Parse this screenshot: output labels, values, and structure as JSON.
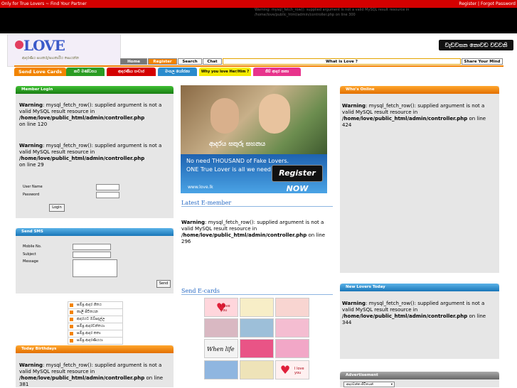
{
  "topbar": {
    "left_text": "Only for True Lovers ~ Find Your Partner",
    "right_text": "Register | Forgot Password"
  },
  "header_warning": {
    "line1": "Warning: mysql_fetch_row(): supplied argument is not a valid MySQL result resource in",
    "line2": "/home/love/public_html/admin/controller.php on line 300"
  },
  "logo": {
    "text": "LOVE",
    "tagline": "ආදරණීය සහකරු/සහකාරිය සොයන්න"
  },
  "site_title": "වැඩවසන නොවඩ වඩවනි",
  "nav": {
    "home": "Home",
    "register": "Register",
    "search": "Search",
    "chat": "Chat",
    "what_is_love": "What is Love ?",
    "share": "Share Your Mind"
  },
  "tabs": {
    "send_love_cards": "Send Love Cards",
    "tab2": "කවි මණ්ඩපය",
    "tab3": "ආදරණීය සංචාර",
    "tab4": "මංගල යෝජනා",
    "tab5": "Why you love Her/Him ?",
    "tab6": "ශිම් ආදර කතා"
  },
  "login": {
    "title": "Member Login",
    "w1_label": "Warning",
    "w1_text": ": mysql_fetch_row(): supplied argument is not a valid MySQL result resource in",
    "w1_path": "/home/love/public_html/admin/controller.php",
    "w1_line": "on line 120",
    "w2_label": "Warning",
    "w2_text": ": mysql_fetch_row(): supplied argument is not a valid MySQL result resource in",
    "w2_path": "/home/love/public_html/admin/controller.php",
    "w2_line": "on line 29",
    "username_label": "User Name",
    "password_label": "Password",
    "button": "Login"
  },
  "sms": {
    "title": "Send SMS",
    "mobile_label": "Mobile No.",
    "subject_label": "Subject",
    "message_label": "Message",
    "button": "Send"
  },
  "menu_list": [
    "සම්ප්‍ර ආදර ගීතය",
    "කාලී ජීවිතයන",
    "ආදරයට ඔබ්සදැල්ල",
    "සම්ප්‍ර ආදරවන්තයා",
    "සම්ප්‍ර ආදර කතා",
    "සම්ප්‍ර ආදරණීයයා"
  ],
  "birthdays": {
    "title": "Today Birthdays",
    "label": "Warning",
    "text": ": mysql_fetch_row(): supplied argument is not a valid MySQL result resource in",
    "path": "/home/love/public_html/admin/controller.php",
    "line": "on line 381"
  },
  "banner": {
    "caption": "ආදරය සතුරු සහනය",
    "line1": "No need THOUSAND of Fake Lovers.",
    "line2": "ONE True Lover is all we need",
    "register": "Register NOW",
    "url": "www.love.lk"
  },
  "latest": {
    "heading": "Latest E-member",
    "label": "Warning",
    "text": ": mysql_fetch_row(): supplied argument is not a valid MySQL result resource in",
    "path": "/home/love/public_html/admin/controller.php",
    "line": "on line 296"
  },
  "ecards": {
    "heading": "Send E-cards",
    "card_text_1": "I love you",
    "card_text_2": "When life",
    "card_text_3": "I love you"
  },
  "online": {
    "title": "Who's Online",
    "label": "Warning",
    "text": ": mysql_fetch_row(): supplied argument is not a valid MySQL result resource in",
    "path": "/home/love/public_html/admin/controller.php",
    "line": "on line 424"
  },
  "new_lovers": {
    "title": "New Lovers Today",
    "label": "Warning",
    "text": ": mysql_fetch_row(): supplied argument is not a valid MySQL result resource in",
    "path": "/home/love/public_html/admin/controller.php",
    "line": "on line 344"
  },
  "ad": {
    "title": "Advertisement",
    "select_value": "ආදරවන්ත-ජීවිතයන්"
  }
}
